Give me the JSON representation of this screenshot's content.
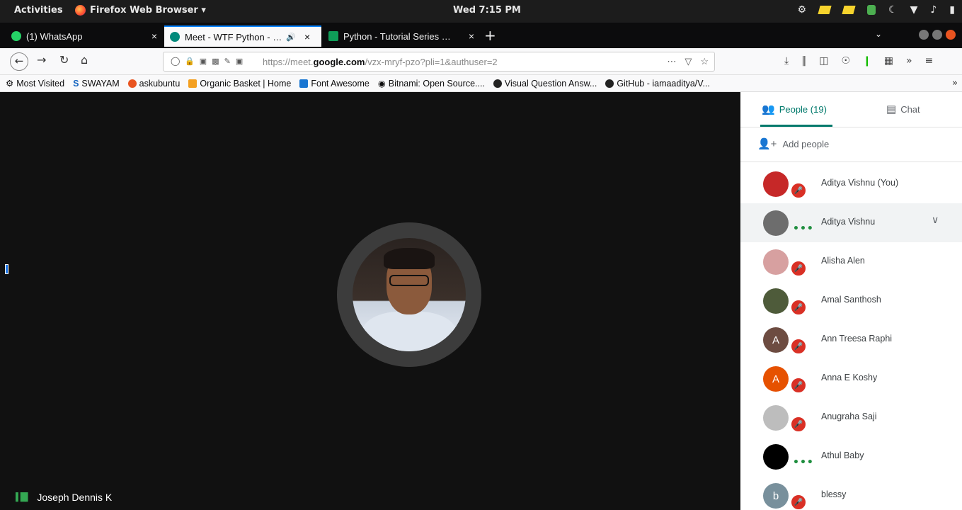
{
  "system_bar": {
    "activities": "Activities",
    "app_menu": "Firefox Web Browser ▾",
    "clock": "Wed  7:15 PM"
  },
  "tabs": [
    {
      "label": "(1) WhatsApp",
      "close": "×",
      "color": "#25d366"
    },
    {
      "label": "Meet - WTF Python - …",
      "close": "×",
      "color": "#00897b",
      "active": true
    },
    {
      "label": "Python - Tutorial Series …",
      "close": "×",
      "color": "#0f9d58"
    }
  ],
  "new_tab": "+",
  "url": {
    "prefix": "https://meet.",
    "domain": "google.com",
    "path": "/vzx-mryf-pzo?pli=1&authuser=2"
  },
  "bookmarks": [
    {
      "label": "Most Visited",
      "color": "#777777"
    },
    {
      "label": "SWAYAM",
      "color": "#1565c0"
    },
    {
      "label": "askubuntu",
      "color": "#e95420"
    },
    {
      "label": "Organic Basket | Home",
      "color": "#f4a020"
    },
    {
      "label": "Font Awesome",
      "color": "#1976d2"
    },
    {
      "label": "Bitnami: Open Source....",
      "color": "#555555"
    },
    {
      "label": "Visual Question Answ...",
      "color": "#222222"
    },
    {
      "label": "GitHub - iamaaditya/V...",
      "color": "#222222"
    }
  ],
  "stage": {
    "speaker_name": "Joseph Dennis K",
    "background": "#111111"
  },
  "panel": {
    "people_tab": "People (19)",
    "chat_tab": "Chat",
    "add_people": "Add people",
    "accent": "#00796b",
    "participants": [
      {
        "name": "Aditya Vishnu (You)",
        "initial": "",
        "avatar_color": "#c62828",
        "muted": true
      },
      {
        "name": "Aditya Vishnu",
        "initial": "",
        "avatar_color": "#6d6d6d",
        "muted": false,
        "highlighted": true
      },
      {
        "name": "Alisha Alen",
        "initial": "",
        "avatar_color": "#d7a0a0",
        "muted": true
      },
      {
        "name": "Amal Santhosh",
        "initial": "",
        "avatar_color": "#4e5b3a",
        "muted": true
      },
      {
        "name": "Ann Treesa Raphi",
        "initial": "A",
        "avatar_color": "#6d4c41",
        "muted": true
      },
      {
        "name": "Anna E Koshy",
        "initial": "A",
        "avatar_color": "#e65100",
        "muted": true
      },
      {
        "name": "Anugraha Saji",
        "initial": "",
        "avatar_color": "#bdbdbd",
        "muted": true
      },
      {
        "name": "Athul Baby",
        "initial": "",
        "avatar_color": "#000000",
        "muted": false
      },
      {
        "name": "blessy",
        "initial": "b",
        "avatar_color": "#78909c",
        "muted": true
      }
    ]
  }
}
